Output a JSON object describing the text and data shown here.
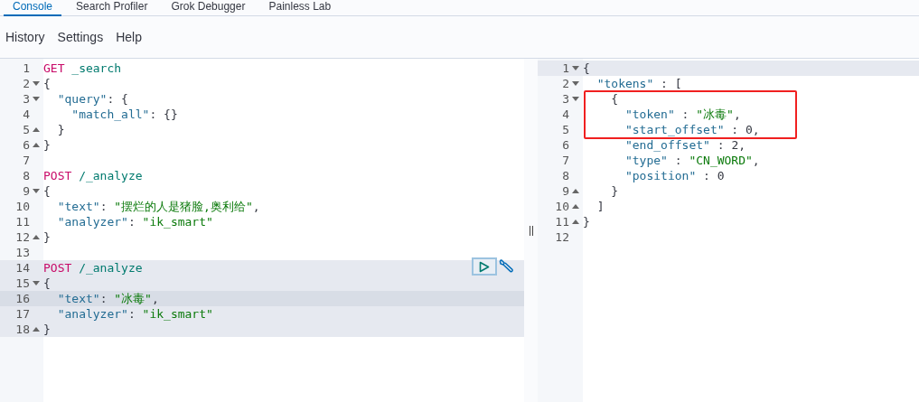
{
  "tabs": [
    {
      "label": "Console",
      "selected": true
    },
    {
      "label": "Search Profiler",
      "selected": false
    },
    {
      "label": "Grok Debugger",
      "selected": false
    },
    {
      "label": "Painless Lab",
      "selected": false
    }
  ],
  "menu": [
    "History",
    "Settings",
    "Help"
  ],
  "request_editor": {
    "lines": [
      {
        "number": "1",
        "fold_start": false,
        "fold_end": false,
        "highlighted": false,
        "active": false,
        "tokens": [
          {
            "kind": "method",
            "text": "GET"
          },
          {
            "kind": "path",
            "text": " _search"
          }
        ]
      },
      {
        "number": "2",
        "fold_start": true,
        "fold_end": false,
        "highlighted": false,
        "active": false,
        "tokens": [
          {
            "kind": "punct",
            "text": "{"
          }
        ]
      },
      {
        "number": "3",
        "fold_start": true,
        "fold_end": false,
        "highlighted": false,
        "active": false,
        "tokens": [
          {
            "kind": "key",
            "text": "  \"query\""
          },
          {
            "kind": "punct",
            "text": ": {"
          }
        ]
      },
      {
        "number": "4",
        "fold_start": false,
        "fold_end": false,
        "highlighted": false,
        "active": false,
        "tokens": [
          {
            "kind": "key",
            "text": "    \"match_all\""
          },
          {
            "kind": "punct",
            "text": ": {}"
          }
        ]
      },
      {
        "number": "5",
        "fold_start": false,
        "fold_end": true,
        "highlighted": false,
        "active": false,
        "tokens": [
          {
            "kind": "punct",
            "text": "  }"
          }
        ]
      },
      {
        "number": "6",
        "fold_start": false,
        "fold_end": true,
        "highlighted": false,
        "active": false,
        "tokens": [
          {
            "kind": "punct",
            "text": "}"
          }
        ]
      },
      {
        "number": "7",
        "fold_start": false,
        "fold_end": false,
        "highlighted": false,
        "active": false
      },
      {
        "number": "8",
        "fold_start": false,
        "fold_end": false,
        "highlighted": false,
        "active": false,
        "tokens": [
          {
            "kind": "method",
            "text": "POST"
          },
          {
            "kind": "path",
            "text": " /_analyze"
          }
        ]
      },
      {
        "number": "9",
        "fold_start": true,
        "fold_end": false,
        "highlighted": false,
        "active": false,
        "tokens": [
          {
            "kind": "punct",
            "text": "{"
          }
        ]
      },
      {
        "number": "10",
        "fold_start": false,
        "fold_end": false,
        "highlighted": false,
        "active": false,
        "tokens": [
          {
            "kind": "key",
            "text": "  \"text\""
          },
          {
            "kind": "punct",
            "text": ": "
          },
          {
            "kind": "string",
            "text": "\"摆烂的人是猪脸,奥利给\""
          },
          {
            "kind": "punct",
            "text": ","
          }
        ]
      },
      {
        "number": "11",
        "fold_start": false,
        "fold_end": false,
        "highlighted": false,
        "active": false,
        "tokens": [
          {
            "kind": "key",
            "text": "  \"analyzer\""
          },
          {
            "kind": "punct",
            "text": ": "
          },
          {
            "kind": "string",
            "text": "\"ik_smart\""
          }
        ]
      },
      {
        "number": "12",
        "fold_start": false,
        "fold_end": true,
        "highlighted": false,
        "active": false,
        "tokens": [
          {
            "kind": "punct",
            "text": "}"
          }
        ]
      },
      {
        "number": "13",
        "fold_start": false,
        "fold_end": false,
        "highlighted": false,
        "active": false
      },
      {
        "number": "14",
        "fold_start": false,
        "fold_end": false,
        "highlighted": true,
        "active": false,
        "tokens": [
          {
            "kind": "method",
            "text": "POST"
          },
          {
            "kind": "path",
            "text": " /_analyze"
          }
        ]
      },
      {
        "number": "15",
        "fold_start": true,
        "fold_end": false,
        "highlighted": true,
        "active": false,
        "tokens": [
          {
            "kind": "punct",
            "text": "{"
          }
        ]
      },
      {
        "number": "16",
        "fold_start": false,
        "fold_end": false,
        "highlighted": true,
        "active": true,
        "tokens": [
          {
            "kind": "key",
            "text": "  \"text\""
          },
          {
            "kind": "punct",
            "text": ": "
          },
          {
            "kind": "string",
            "text": "\"冰毒\""
          },
          {
            "kind": "punct",
            "text": ","
          }
        ]
      },
      {
        "number": "17",
        "fold_start": false,
        "fold_end": false,
        "highlighted": true,
        "active": false,
        "tokens": [
          {
            "kind": "key",
            "text": "  \"analyzer\""
          },
          {
            "kind": "punct",
            "text": ": "
          },
          {
            "kind": "string",
            "text": "\"ik_smart\""
          }
        ]
      },
      {
        "number": "18",
        "fold_start": false,
        "fold_end": true,
        "highlighted": true,
        "active": false,
        "tokens": [
          {
            "kind": "punct",
            "text": "}"
          }
        ]
      }
    ]
  },
  "response_editor": {
    "lines": [
      {
        "number": "1",
        "fold_start": true,
        "fold_end": false,
        "highlighted": true,
        "active": false,
        "tokens": [
          {
            "kind": "punct",
            "text": "{"
          }
        ]
      },
      {
        "number": "2",
        "fold_start": true,
        "fold_end": false,
        "highlighted": false,
        "active": false,
        "tokens": [
          {
            "kind": "key",
            "text": "  \"tokens\""
          },
          {
            "kind": "punct",
            "text": " : ["
          }
        ]
      },
      {
        "number": "3",
        "fold_start": true,
        "fold_end": false,
        "highlighted": false,
        "active": false,
        "tokens": [
          {
            "kind": "punct",
            "text": "    {"
          }
        ]
      },
      {
        "number": "4",
        "fold_start": false,
        "fold_end": false,
        "highlighted": false,
        "active": false,
        "tokens": [
          {
            "kind": "key",
            "text": "      \"token\""
          },
          {
            "kind": "punct",
            "text": " : "
          },
          {
            "kind": "string",
            "text": "\"冰毒\""
          },
          {
            "kind": "punct",
            "text": ","
          }
        ]
      },
      {
        "number": "5",
        "fold_start": false,
        "fold_end": false,
        "highlighted": false,
        "active": false,
        "tokens": [
          {
            "kind": "key",
            "text": "      \"start_offset\""
          },
          {
            "kind": "punct",
            "text": " : "
          },
          {
            "kind": "number",
            "text": "0"
          },
          {
            "kind": "punct",
            "text": ","
          }
        ]
      },
      {
        "number": "6",
        "fold_start": false,
        "fold_end": false,
        "highlighted": false,
        "active": false,
        "tokens": [
          {
            "kind": "key",
            "text": "      \"end_offset\""
          },
          {
            "kind": "punct",
            "text": " : "
          },
          {
            "kind": "number",
            "text": "2"
          },
          {
            "kind": "punct",
            "text": ","
          }
        ]
      },
      {
        "number": "7",
        "fold_start": false,
        "fold_end": false,
        "highlighted": false,
        "active": false,
        "tokens": [
          {
            "kind": "key",
            "text": "      \"type\""
          },
          {
            "kind": "punct",
            "text": " : "
          },
          {
            "kind": "string",
            "text": "\"CN_WORD\""
          },
          {
            "kind": "punct",
            "text": ","
          }
        ]
      },
      {
        "number": "8",
        "fold_start": false,
        "fold_end": false,
        "highlighted": false,
        "active": false,
        "tokens": [
          {
            "kind": "key",
            "text": "      \"position\""
          },
          {
            "kind": "punct",
            "text": " : "
          },
          {
            "kind": "number",
            "text": "0"
          }
        ]
      },
      {
        "number": "9",
        "fold_start": false,
        "fold_end": true,
        "highlighted": false,
        "active": false,
        "tokens": [
          {
            "kind": "punct",
            "text": "    }"
          }
        ]
      },
      {
        "number": "10",
        "fold_start": false,
        "fold_end": true,
        "highlighted": false,
        "active": false,
        "tokens": [
          {
            "kind": "punct",
            "text": "  ]"
          }
        ]
      },
      {
        "number": "11",
        "fold_start": false,
        "fold_end": true,
        "highlighted": false,
        "active": false,
        "tokens": [
          {
            "kind": "punct",
            "text": "}"
          }
        ]
      },
      {
        "number": "12",
        "fold_start": false,
        "fold_end": false,
        "highlighted": false,
        "active": false
      }
    ]
  }
}
